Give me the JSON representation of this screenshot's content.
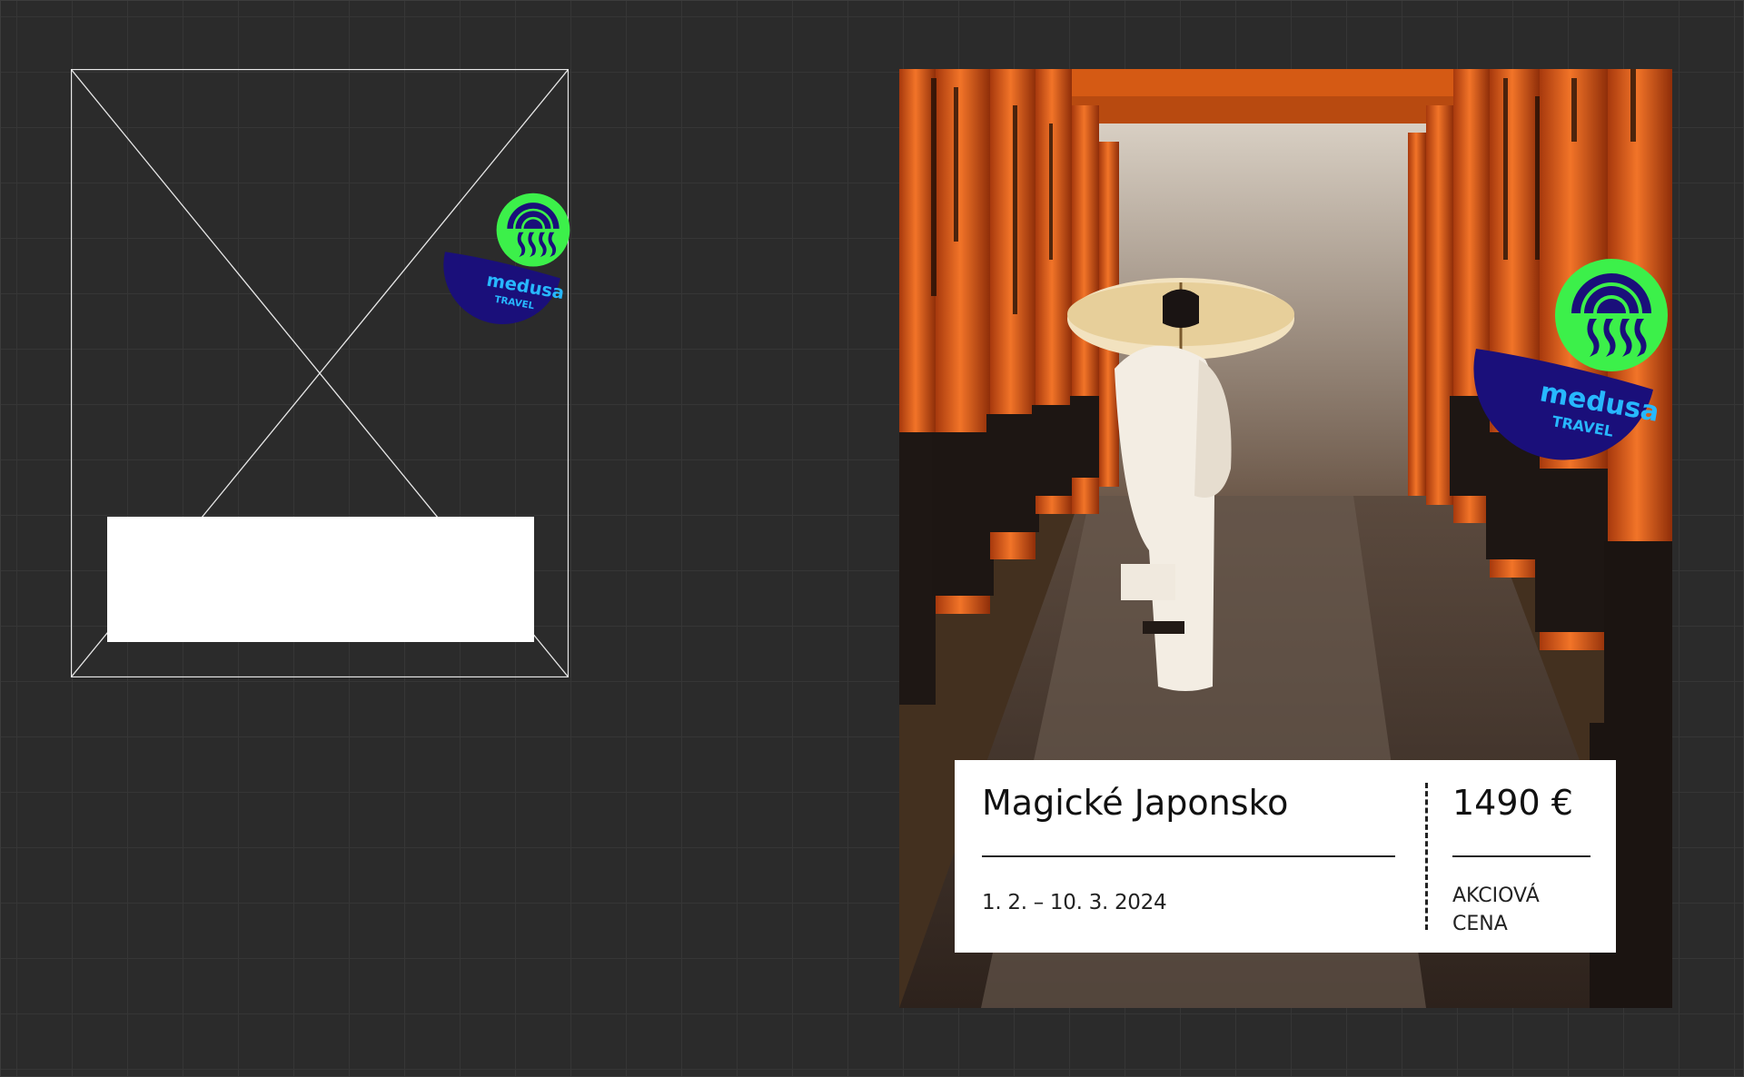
{
  "wireframe": {
    "badge": {
      "brand": "medusa",
      "sub": "TRAVEL"
    }
  },
  "poster": {
    "badge": {
      "brand": "medusa",
      "sub": "TRAVEL"
    },
    "card": {
      "title": "Magické Japonsko",
      "dates": "1. 2. – 10. 3. 2024",
      "price": "1490 €",
      "note_line1": "AKCIOVÁ",
      "note_line2": "CENA"
    }
  },
  "colors": {
    "background": "#2b2b2b",
    "badge_green": "#3cf04a",
    "badge_navy": "#1a0f7a",
    "badge_text": "#27b8ff",
    "torii_orange": "#e8621a"
  },
  "icons": [
    "jellyfish-icon"
  ]
}
